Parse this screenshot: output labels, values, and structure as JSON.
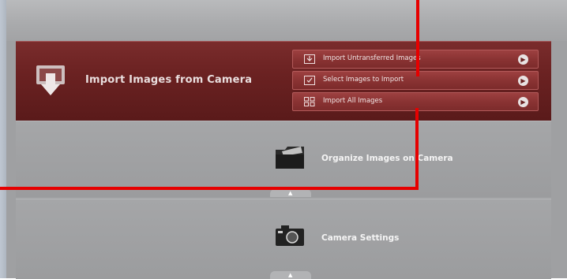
{
  "import_panel": {
    "title": "Import Images from Camera",
    "icon": "import-arrow-icon",
    "items": [
      {
        "label": "Import Untransferred Images",
        "icon": "untransferred-icon"
      },
      {
        "label": "Select Images to Import",
        "icon": "select-icon"
      },
      {
        "label": "Import All Images",
        "icon": "grid-icon"
      }
    ],
    "arrow_glyph": "▶"
  },
  "organize_panel": {
    "title": "Organize Images on Camera",
    "icon": "folder-icon"
  },
  "camera_panel": {
    "title": "Camera Settings",
    "icon": "camera-icon"
  },
  "colors": {
    "import_bg": "#6b2222",
    "submenu_bg": "#8a3333",
    "panel_bg": "#a0a1a3",
    "annotation": "#e60000"
  }
}
